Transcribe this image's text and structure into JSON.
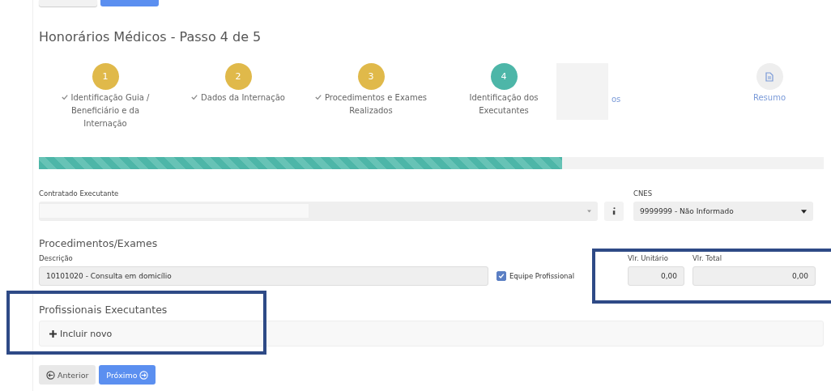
{
  "title": "Honorários Médicos - Passo 4 de 5",
  "steps": [
    {
      "kind": "done",
      "number": "1",
      "label": "Identificação Guia / Beneficiário e da Internação"
    },
    {
      "kind": "done",
      "number": "2",
      "label": "Dados da Internação"
    },
    {
      "kind": "done",
      "number": "3",
      "label": "Procedimentos e Exames Realizados"
    },
    {
      "kind": "current",
      "number": "4",
      "label": "Identificação dos Executantes"
    },
    {
      "kind": "hidden",
      "label": "os"
    },
    {
      "kind": "pending",
      "label": "Resumo"
    }
  ],
  "progress": {
    "level": 0.667
  },
  "contratado": {
    "label": "Contratado Executante"
  },
  "cnes": {
    "label": "CNES",
    "value": "9999999 - Não Informado"
  },
  "procedimentos": {
    "heading": "Procedimentos/Exames",
    "descricao_label": "Descrição",
    "descricao": "10101020 - Consulta em domicílio",
    "equipe": {
      "label": "Equipe Profissional",
      "checked": true
    },
    "unitario_label": "Vlr. Unitário",
    "unitario": "0,00",
    "total_label": "Vlr. Total",
    "total": "0,00"
  },
  "profissionais": {
    "heading": "Profissionais Executantes",
    "add": "Incluir novo"
  },
  "buttons": [
    {
      "kind": "back",
      "label": "Anterior"
    },
    {
      "kind": "next",
      "label": "Próximo"
    }
  ]
}
